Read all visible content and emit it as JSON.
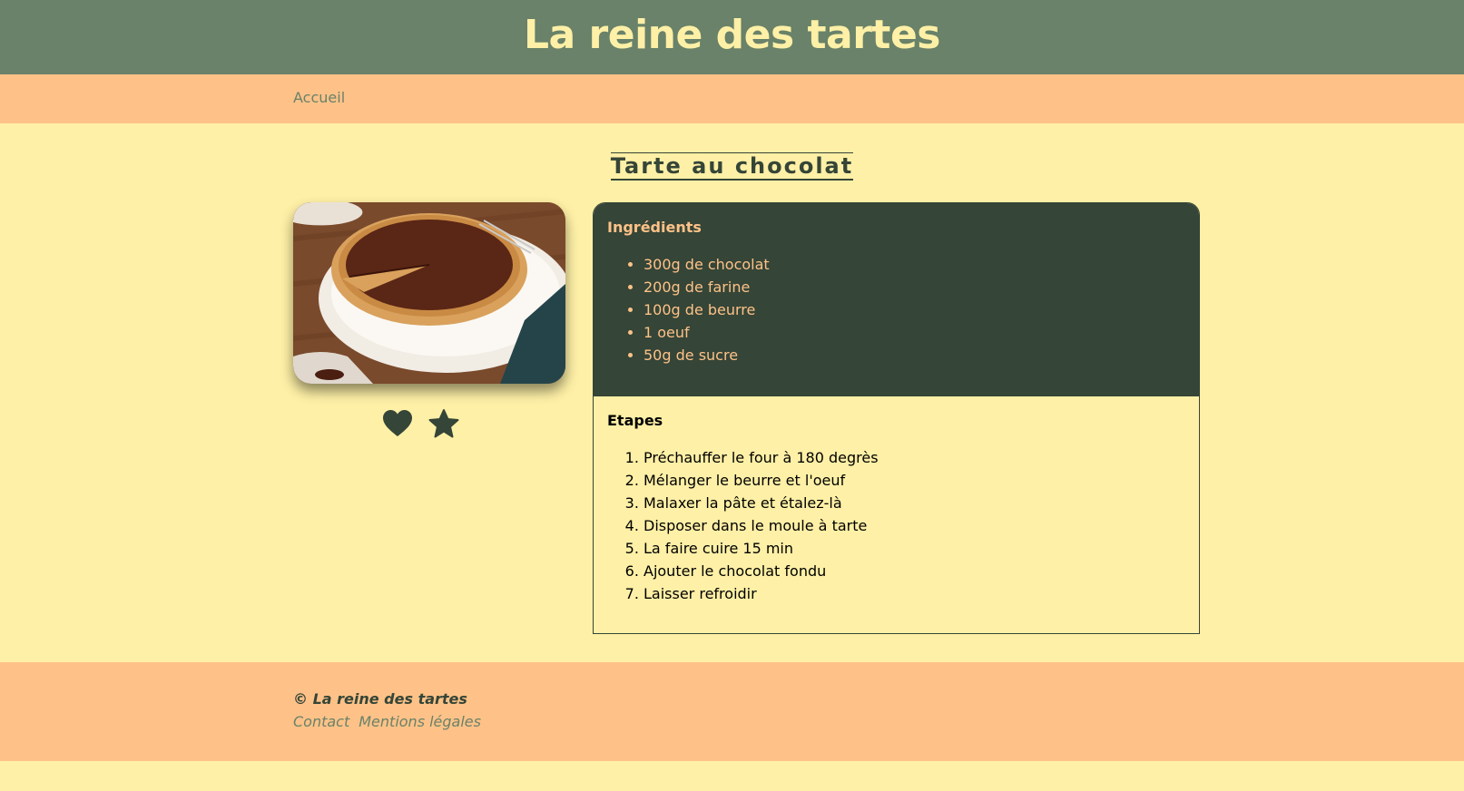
{
  "header": {
    "title": "La reine des tartes"
  },
  "nav": {
    "home_label": "Accueil"
  },
  "recipe": {
    "title": "Tarte au chocolat",
    "ingredients_heading": "Ingrédients",
    "ingredients": [
      "300g de chocolat",
      "200g de farine",
      "100g de beurre",
      "1 oeuf",
      "50g de sucre"
    ],
    "steps_heading": "Etapes",
    "steps": [
      "Préchauffer le four à 180 degrès",
      "Mélanger le beurre et l'oeuf",
      "Malaxer la pâte et étalez-là",
      "Disposer dans le moule à tarte",
      "La faire cuire 15 min",
      "Ajouter le chocolat fondu",
      "Laisser refroidir"
    ]
  },
  "actions": {
    "favorite_icon": "heart-icon",
    "rate_icon": "star-icon"
  },
  "footer": {
    "copyright": "© La reine des tartes",
    "links": [
      "Contact",
      "Mentions légales"
    ]
  },
  "colors": {
    "header_bg": "#698269",
    "title": "#FEF0A6",
    "nav_bg": "#FEC288",
    "page_bg": "#FEF0A6",
    "dark_green": "#354537",
    "accent": "#FEC288"
  }
}
